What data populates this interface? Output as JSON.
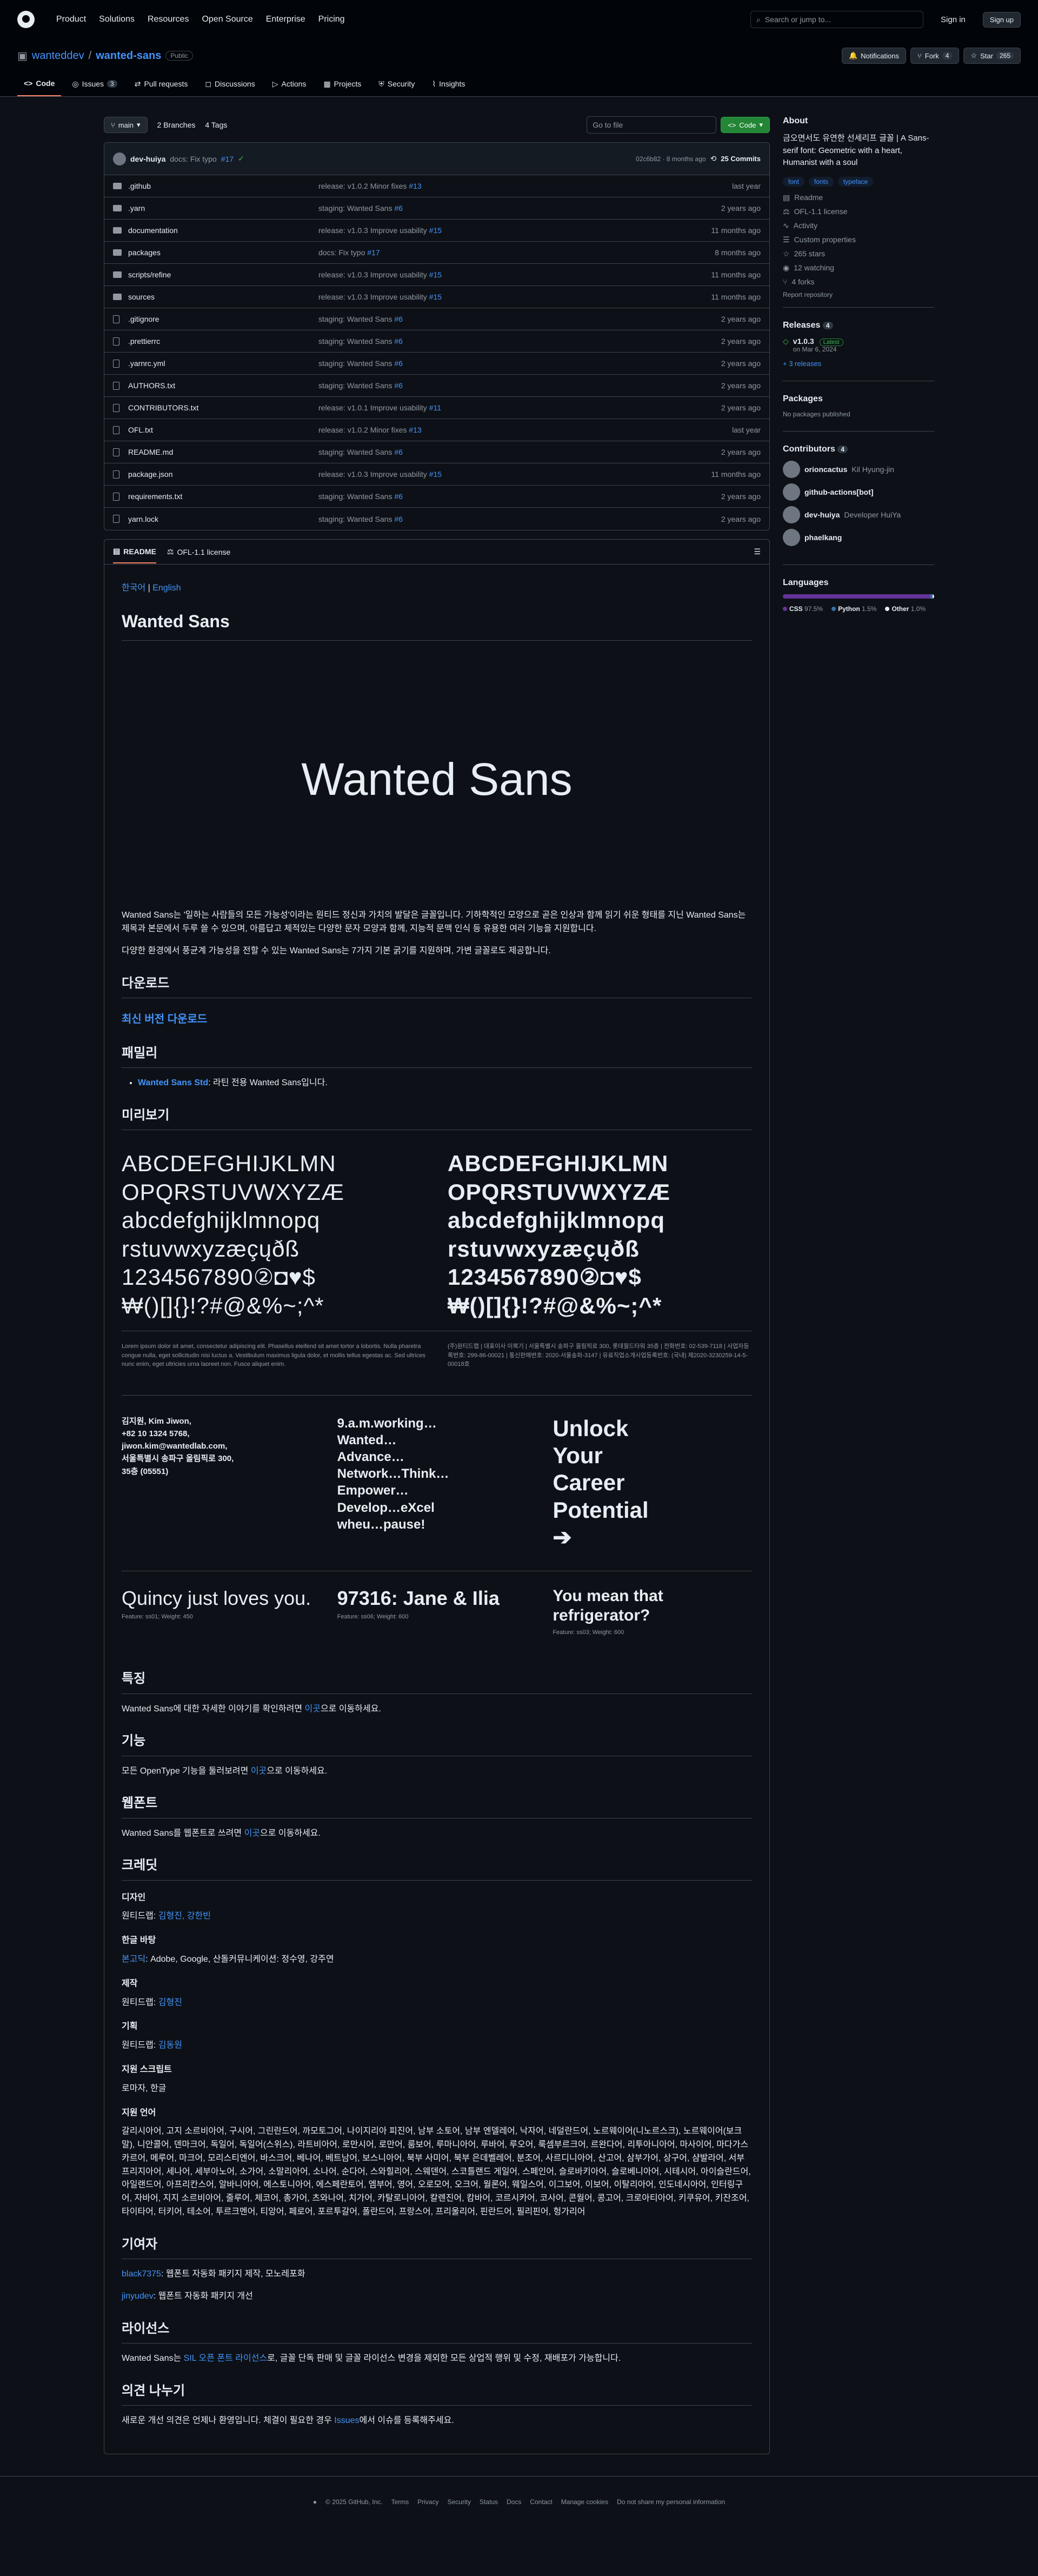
{
  "header": {
    "nav": [
      "Product",
      "Solutions",
      "Resources",
      "Open Source",
      "Enterprise",
      "Pricing"
    ],
    "search": "Search or jump to...",
    "signin": "Sign in",
    "signup": "Sign up"
  },
  "repo": {
    "owner": "wanteddev",
    "name": "wanted-sans",
    "visibility": "Public",
    "notifications": "Notifications",
    "fork": "Fork",
    "fork_count": "4",
    "star": "Star",
    "star_count": "265"
  },
  "tabs": [
    {
      "label": "Code"
    },
    {
      "label": "Issues",
      "count": "3"
    },
    {
      "label": "Pull requests"
    },
    {
      "label": "Discussions"
    },
    {
      "label": "Actions"
    },
    {
      "label": "Projects"
    },
    {
      "label": "Security"
    },
    {
      "label": "Insights"
    }
  ],
  "toolbar": {
    "branch": "main",
    "branches": "2 Branches",
    "tags": "4 Tags",
    "goto": "Go to file",
    "code": "Code"
  },
  "commit": {
    "author": "dev-huiya",
    "message": "docs: Fix typo",
    "pr": "#17",
    "hash": "02c6b82 · 8 months ago",
    "count": "25 Commits"
  },
  "files": [
    {
      "type": "dir",
      "name": ".github",
      "msg": "release: v1.0.2 Minor fixes",
      "pr": "#13",
      "date": "last year"
    },
    {
      "type": "dir",
      "name": ".yarn",
      "msg": "staging: Wanted Sans",
      "pr": "#6",
      "date": "2 years ago"
    },
    {
      "type": "dir",
      "name": "documentation",
      "msg": "release: v1.0.3 Improve usability",
      "pr": "#15",
      "date": "11 months ago"
    },
    {
      "type": "dir",
      "name": "packages",
      "msg": "docs: Fix typo",
      "pr": "#17",
      "date": "8 months ago"
    },
    {
      "type": "dir",
      "name": "scripts/refine",
      "msg": "release: v1.0.3 Improve usability",
      "pr": "#15",
      "date": "11 months ago"
    },
    {
      "type": "dir",
      "name": "sources",
      "msg": "release: v1.0.3 Improve usability",
      "pr": "#15",
      "date": "11 months ago"
    },
    {
      "type": "file",
      "name": ".gitignore",
      "msg": "staging: Wanted Sans",
      "pr": "#6",
      "date": "2 years ago"
    },
    {
      "type": "file",
      "name": ".prettierrc",
      "msg": "staging: Wanted Sans",
      "pr": "#6",
      "date": "2 years ago"
    },
    {
      "type": "file",
      "name": ".yarnrc.yml",
      "msg": "staging: Wanted Sans",
      "pr": "#6",
      "date": "2 years ago"
    },
    {
      "type": "file",
      "name": "AUTHORS.txt",
      "msg": "staging: Wanted Sans",
      "pr": "#6",
      "date": "2 years ago"
    },
    {
      "type": "file",
      "name": "CONTRIBUTORS.txt",
      "msg": "release: v1.0.1 Improve usability",
      "pr": "#11",
      "date": "2 years ago"
    },
    {
      "type": "file",
      "name": "OFL.txt",
      "msg": "release: v1.0.2 Minor fixes",
      "pr": "#13",
      "date": "last year"
    },
    {
      "type": "file",
      "name": "README.md",
      "msg": "staging: Wanted Sans",
      "pr": "#6",
      "date": "2 years ago"
    },
    {
      "type": "file",
      "name": "package.json",
      "msg": "release: v1.0.3 Improve usability",
      "pr": "#15",
      "date": "11 months ago"
    },
    {
      "type": "file",
      "name": "requirements.txt",
      "msg": "staging: Wanted Sans",
      "pr": "#6",
      "date": "2 years ago"
    },
    {
      "type": "file",
      "name": "yarn.lock",
      "msg": "staging: Wanted Sans",
      "pr": "#6",
      "date": "2 years ago"
    }
  ],
  "readme": {
    "tab1": "README",
    "tab2": "OFL-1.1 license",
    "lang_ko": "한국어",
    "lang_sep": " | ",
    "lang_en": "English",
    "title": "Wanted Sans",
    "hero": "Wanted Sans",
    "intro1": "Wanted Sans는 '일하는 사람들의 모든 가능성'이라는 원티드 정신과 가치의 발달은 글꼴입니다. 기하학적인 모양으로 곧은 인상과 함께 읽기 쉬운 형태를 지닌 Wanted Sans는 제목과 본문에서 두루 쓸 수 있으며, 아름답고 체적있는 다양한 문자 모양과 함께, 지능적 문맥 인식 등 유용한 여러 기능을 지원합니다.",
    "intro2": "다양한 환경에서 풍균계 가능성을 전할 수 있는 Wanted Sans는 7가지 기본 굵기를 지원하며, 가변 글꼴로도 제공합니다.",
    "h_download": "다운로드",
    "download_link": "최신 버전 다운로드",
    "h_family": "패밀리",
    "family_item_link": "Wanted Sans Std",
    "family_item_text": ": 라틴 전용 Wanted Sans입니다.",
    "h_preview": "미리보기",
    "glyph_lines": [
      "ABCDEFGHIJKLMN",
      "OPQRSTUVWXYZÆ",
      "abcdefghijklmnopq",
      "rstuvwxyzæçųðß",
      "1234567890②◘♥$",
      "₩()[]{}!?#@&%~;^*"
    ],
    "lorem_left": "Lorem ipsum dolor sit amet, consectetur adipiscing elit. Phasellus eleifend sit amet tortor a lobortis. Nulla pharetra congue nulla, eget sollicitudin nisi luctus a. Vestibulum maximus ligula dolor, et mollis tellus egestas ac. Sed ultrices nunc enim, eget ultricies urna laoreet non. Fusce aliquet enim.",
    "lorem_right": "(주)원티드랩 | 대표이사 이복기 | 서울특별시 송파구 올림픽로 300, 롯데월드타워 35층 | 전화번호: 02-539-7118 | 사업자등록번호: 299-86-00021 | 통신판매번호: 2020-서울송파-3147 | 유료직업소개사업등록번호: (국내) 제2020-3230259-14-5-00018호",
    "s1": "김지원, Kim Jiwon,\n+82 10 1324 5768,\njiwon.kim@wantedlab.com,\n서울특별시 송파구 올림픽로 300,\n35층 (05551)",
    "s2": "9.a.m.working…\nWanted…\nAdvance…\nNetwork…Think…\nEmpower…\nDevelop…eXcel\nwheu…pause!",
    "s3": "Unlock\nYour\nCareer\nPotential\n➔",
    "f1": "Quincy just loves you.",
    "f1c": "Feature: ss01; Weight: 450",
    "f2": "97316: Jane & Ilia",
    "f2c": "Feature: ss06; Weight: 600",
    "f3": "You mean that refrigerator?",
    "f3c": "Feature: ss03; Weight: 600",
    "h_features": "특징",
    "features_text": "Wanted Sans에 대한 자세한 이야기를 확인하려면 ",
    "here": "이곳",
    "features_tail": "으로 이동하세요.",
    "h_func": "기능",
    "func_text": "모든 OpenType 기능을 둘러보려면 ",
    "func_tail": "으로 이동하세요.",
    "h_web": "웹폰트",
    "web_text": "Wanted Sans를 웹폰트로 쓰려면 ",
    "web_tail": "으로 이동하세요.",
    "h_credits": "크레딧",
    "h_design": "디자인",
    "design_text": "원티드랩: ",
    "design_names": "김형진, 강한빈",
    "h_font": "한글 바탕",
    "font_link": "본고딕",
    "font_text": ": Adobe, Google, 산돌커뮤니케이션: 정수영, 강주연",
    "h_prod": "제작",
    "prod_text": "원티드랩: ",
    "prod_names": "김형진",
    "h_plan": "기획",
    "plan_text": "원티드랩: ",
    "plan_names": "김동원",
    "h_script": "지원 스크립트",
    "script_text": "로마자, 한글",
    "h_lang": "지원 언어",
    "lang_text": "갈리시아어, 고지 소르비아어, 구시어, 그린란드어, 까모토그어, 나이지리아 피진어, 남부 소토어, 남부 엔델레어, 낙자어, 네덜란드어, 노르웨이어(니노르스크), 노르웨이어(보크말), 니안콜어, 덴마크어, 독일어, 독일어(스위스), 라트비아어, 로만시어, 로만어, 룸보어, 루마니아어, 루바어, 루오어, 룩셈부르크어, 르완다어, 리투아니아어, 마사이어, 마다가스카르어, 메루어, 마크어, 모리스티엔어, 바스크어, 베나어, 베트남어, 보스니아어, 북부 사미어, 북부 은데벨레어, 분조어, 사르디니아어, 산고어, 삼부가어, 상구어, 샴발라어, 서부 프리지아어, 세나어, 세부아노어, 소가어, 소말리아어, 소나어, 순다어, 스와힐리어, 스웨덴어, 스코틀랜드 게일어, 스페인어, 슬로바키아어, 슬로베니아어, 시테시어, 아이슬란드어, 아일랜드어, 아프리칸스어, 알바니아어, 에스토니아어, 에스페란토어, 엠부어, 영어, 오로모어, 오크어, 월론어, 웨일스어, 이그보어, 이보어, 이탈리아어, 인도네시아어, 인터링구어, 자바어, 지지 소르비아어, 줄루어, 체코어, 총가어, 츠와나어, 치가어, 카탈로니아어, 칼렌진어, 캄바어, 코르시카어, 코사어, 콘월어, 콩고어, 크로아티아어, 키쿠유어, 키잔조어, 타이타어, 터키어, 테소어, 투르크멘어, 티앙어, 페로어, 포르투갈어, 폴란드어, 프랑스어, 프리울리어, 핀란드어, 필리핀어, 헝가리어",
    "h_contrib": "기여자",
    "c1_link": "black7375",
    "c1_text": ": 웹폰트 자동화 패키지 제작, 모노레포화",
    "c2_link": "jinyudev",
    "c2_text": ": 웹폰트 자동화 패키지 개선",
    "h_license": "라이선스",
    "license_pre": "Wanted Sans는 ",
    "license_link": "SIL 오픈 폰트 라이선스",
    "license_post": "로, 글꼴 단독 판매 및 글꼴 라이선스 변경을 제외한 모든 상업적 행위 및 수정, 재배포가 가능합니다.",
    "h_feedback": "의견 나누기",
    "feedback_pre": "새로운 개선 의견은 언제나 환영입니다. 체결이 필요한 경우 ",
    "feedback_link": "Issues",
    "feedback_post": "에서 이슈를 등록해주세요."
  },
  "about": {
    "title": "About",
    "desc": "금오면서도 유연한 선세리프 글꼴 | A Sans-serif font: Geometric with a heart, Humanist with a soul",
    "topics": [
      "font",
      "fonts",
      "typeface"
    ],
    "links": [
      "Readme",
      "OFL-1.1 license",
      "Activity",
      "Custom properties",
      "265 stars",
      "12 watching",
      "4 forks"
    ],
    "report": "Report repository"
  },
  "releases": {
    "title": "Releases",
    "count": "4",
    "version": "v1.0.3",
    "latest": "Latest",
    "date": "on Mar 6, 2024",
    "more": "+ 3 releases"
  },
  "packages": {
    "title": "Packages",
    "text": "No packages published"
  },
  "contributors": {
    "title": "Contributors",
    "count": "4",
    "list": [
      {
        "name": "orioncactus",
        "sub": "Kil Hyung-jin"
      },
      {
        "name": "github-actions[bot]",
        "sub": ""
      },
      {
        "name": "dev-huiya",
        "sub": "Developer HuiYa"
      },
      {
        "name": "phaelkang",
        "sub": ""
      }
    ]
  },
  "languages": {
    "title": "Languages",
    "list": [
      {
        "name": "CSS",
        "pct": "97.5%",
        "value": 97.5,
        "color": "#663399"
      },
      {
        "name": "Python",
        "pct": "1.5%",
        "value": 1.5,
        "color": "#3572a5"
      },
      {
        "name": "Other",
        "pct": "1.0%",
        "value": 1.0,
        "color": "#e6edf3"
      }
    ]
  },
  "footer": {
    "copy": "© 2025 GitHub, Inc.",
    "links": [
      "Terms",
      "Privacy",
      "Security",
      "Status",
      "Docs",
      "Contact",
      "Manage cookies",
      "Do not share my personal information"
    ]
  }
}
